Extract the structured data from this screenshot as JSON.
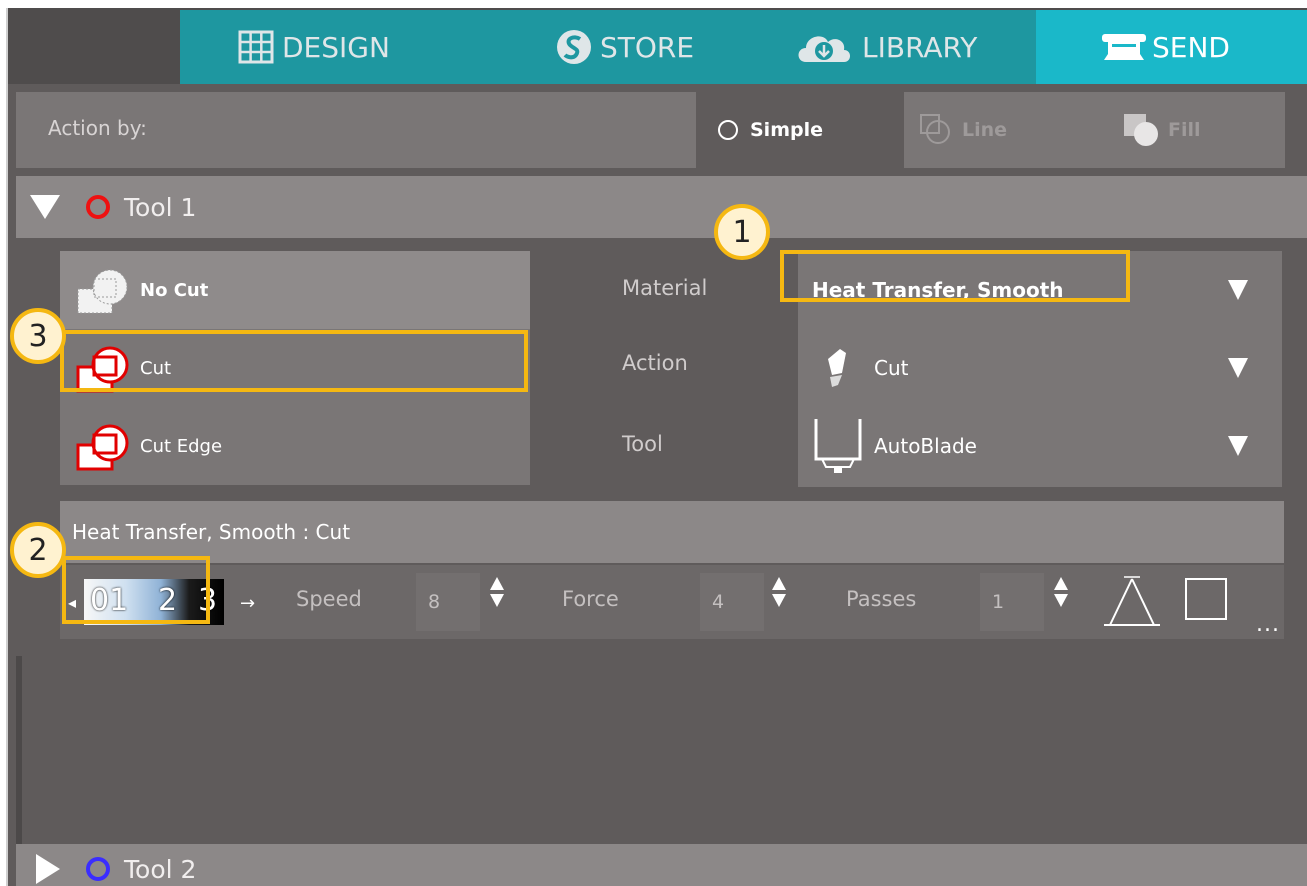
{
  "nav": {
    "items": [
      {
        "label": "DESIGN",
        "icon": "grid-icon"
      },
      {
        "label": "STORE",
        "icon": "silhouette-s-icon"
      },
      {
        "label": "LIBRARY",
        "icon": "cloud-download-icon"
      },
      {
        "label": "SEND",
        "icon": "cutter-machine-icon",
        "active": true
      }
    ],
    "colors": {
      "bar": "#1e97a0",
      "active": "#1ab8c9"
    }
  },
  "action_by": {
    "label": "Action by:",
    "options": [
      {
        "label": "Simple",
        "selected": true
      },
      {
        "label": "Line",
        "selected": false
      },
      {
        "label": "Fill",
        "selected": false
      }
    ]
  },
  "tool1": {
    "title": "Tool 1",
    "color": "#e11111",
    "cut_options": [
      {
        "label": "No Cut",
        "selected": true
      },
      {
        "label": "Cut",
        "selected": false
      },
      {
        "label": "Cut Edge",
        "selected": false
      }
    ],
    "settings": {
      "material_label": "Material",
      "material_value": "Heat Transfer, Smooth",
      "action_label": "Action",
      "action_value": "Cut",
      "tool_label": "Tool",
      "tool_value": "AutoBlade"
    },
    "summary": "Heat Transfer, Smooth : Cut",
    "preset_digits": [
      "01",
      "2",
      "3"
    ],
    "params": {
      "speed_label": "Speed",
      "speed_value": "8",
      "force_label": "Force",
      "force_value": "4",
      "passes_label": "Passes",
      "passes_value": "1"
    },
    "more": "..."
  },
  "tool2": {
    "title": "Tool 2",
    "color": "#3a2dff"
  },
  "callouts": [
    "1",
    "2",
    "3"
  ],
  "highlight_color": "#f5b812"
}
